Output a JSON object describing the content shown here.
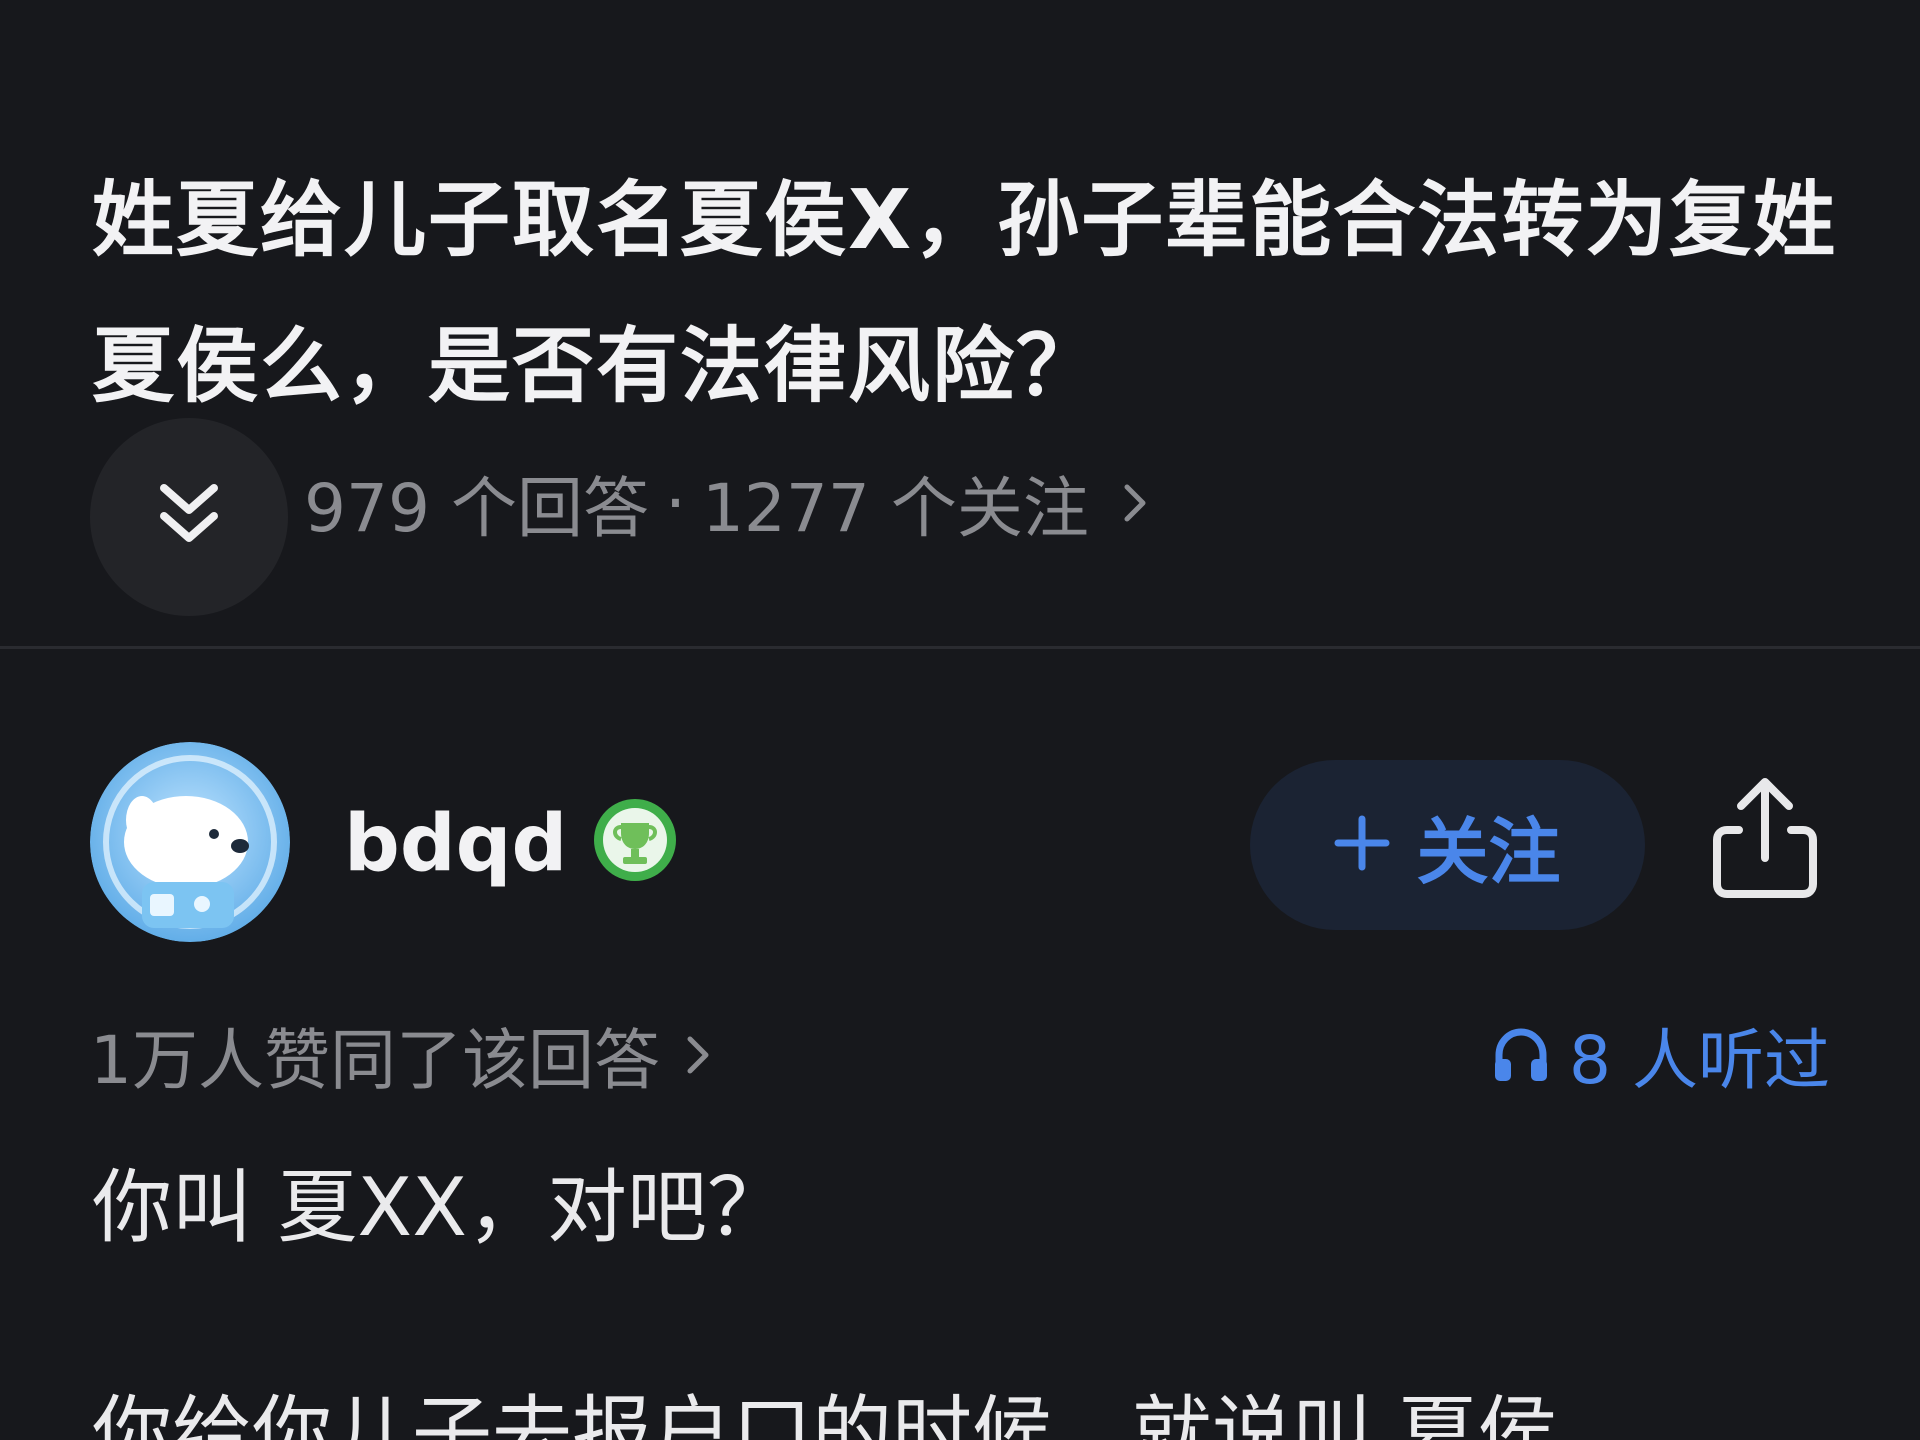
{
  "question": {
    "title": "姓夏给儿子取名夏侯X，孙子辈能合法转为复姓夏侯么，是否有法律风险？",
    "answers_count": "979 个回答",
    "separator": "·",
    "followers_count": "1277 个关注"
  },
  "answer": {
    "author": {
      "username": "bdqd",
      "badge_icon": "trophy-icon"
    },
    "follow_label": "关注",
    "approvals_text": "1万人赞同了该回答",
    "listened_text": "8 人听过",
    "body_line1": "你叫 夏XX，对吧？",
    "body_line2": "你给你儿子去报户口的时候，就说叫 夏侯"
  },
  "colors": {
    "background": "#17181c",
    "accent_blue": "#4a86ea",
    "muted_text": "#8a8b90",
    "badge_green": "#3fae4a"
  }
}
